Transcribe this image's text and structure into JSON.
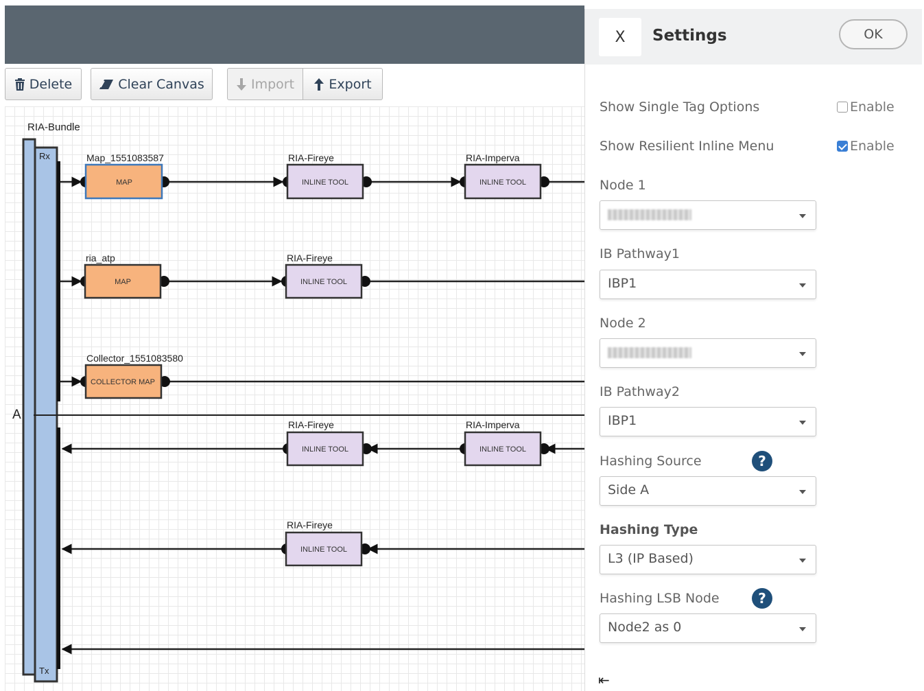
{
  "toolbar": {
    "delete_label": "Delete",
    "clear_label": "Clear Canvas",
    "import_label": "Import",
    "export_label": "Export"
  },
  "canvas": {
    "bundle_label": "RIA-Bundle",
    "rx_label": "Rx",
    "tx_label": "Tx",
    "side_label": "A",
    "labels": {
      "map1": "Map_1551083587",
      "map1_text": "MAP",
      "fireye1": "RIA-Fireye",
      "imperva1": "RIA-Imperva",
      "ria_atp": "ria_atp",
      "map2_text": "MAP",
      "fireye2": "RIA-Fireye",
      "collector": "Collector_1551083580",
      "collector_text": "COLLECTOR MAP",
      "fireye3": "RIA-Fireye",
      "imperva3": "RIA-Imperva",
      "fireye4": "RIA-Fireye",
      "inline_tool": "INLINE TOOL"
    }
  },
  "settings": {
    "title": "Settings",
    "close_label": "X",
    "ok_label": "OK",
    "single_tag_label": "Show Single Tag Options",
    "single_tag_enable": "Enable",
    "resilient_label": "Show Resilient Inline Menu",
    "resilient_enable": "Enable",
    "node1_label": "Node 1",
    "ibp1_label": "IB Pathway1",
    "ibp1_value": "IBP1",
    "node2_label": "Node 2",
    "ibp2_label": "IB Pathway2",
    "ibp2_value": "IBP1",
    "hash_source_label": "Hashing Source",
    "hash_source_value": "Side A",
    "hash_type_label": "Hashing Type",
    "hash_type_value": "L3 (IP Based)",
    "hash_lsb_label": "Hashing LSB Node",
    "hash_lsb_value": "Node2 as 0",
    "help_glyph": "?",
    "collapse_glyph": "⇤"
  }
}
